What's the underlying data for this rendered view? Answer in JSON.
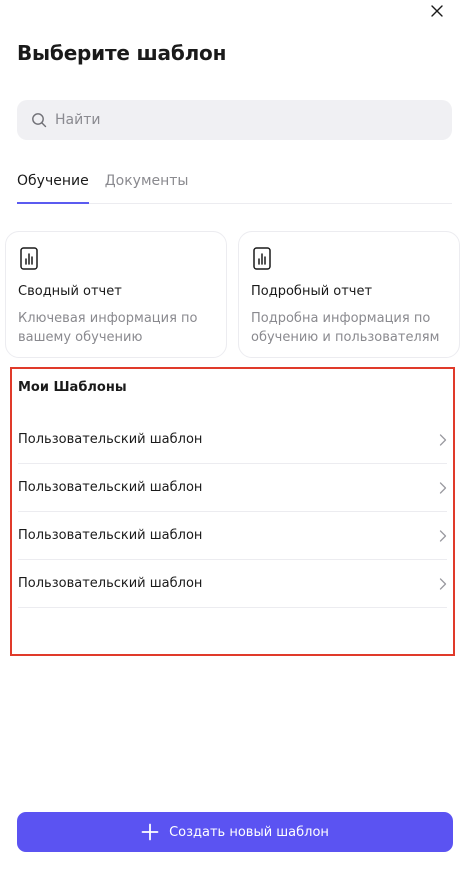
{
  "dialog": {
    "title": "Выберите шаблон",
    "close_icon": "close-icon"
  },
  "search": {
    "placeholder": "Найти",
    "value": "",
    "icon": "search-icon"
  },
  "tabs": [
    {
      "label": "Обучение",
      "active": true
    },
    {
      "label": "Документы",
      "active": false
    }
  ],
  "cards": [
    {
      "icon": "bar-chart-icon",
      "title": "Сводный отчет",
      "description": "Ключевая информация по вашему обучению"
    },
    {
      "icon": "bar-chart-icon",
      "title": "Подробный отчет",
      "description": "Подробна информация по обучению и пользователям"
    }
  ],
  "my_templates": {
    "title": "Мои Шаблоны",
    "items": [
      {
        "label": "Пользовательский шаблон"
      },
      {
        "label": "Пользовательский шаблон"
      },
      {
        "label": "Пользовательский шаблон"
      },
      {
        "label": "Пользовательский шаблон"
      }
    ]
  },
  "create_button": {
    "label": "Создать новый шаблон",
    "icon": "plus-icon"
  },
  "colors": {
    "accent": "#5b53f2",
    "highlight_border": "#e03a2a"
  }
}
